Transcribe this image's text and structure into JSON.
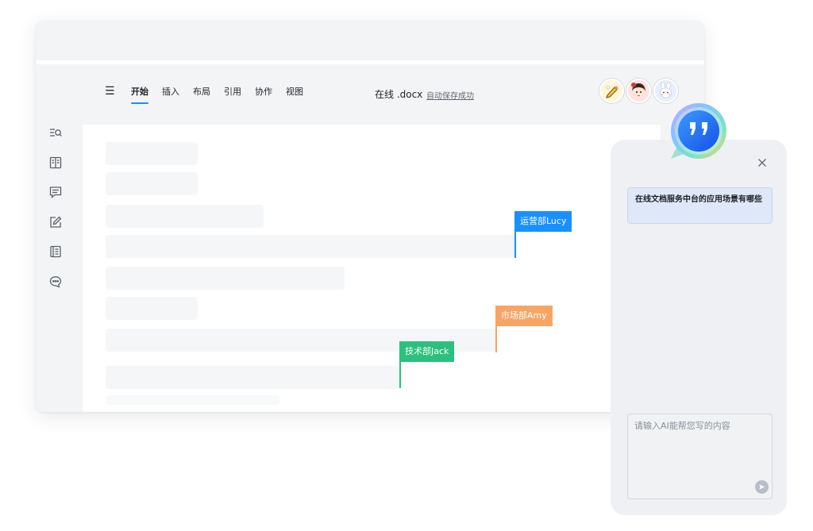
{
  "toolbar": {
    "menu_icon": "hamburger-menu-icon",
    "tabs": [
      {
        "label": "开始",
        "active": true
      },
      {
        "label": "插入",
        "active": false
      },
      {
        "label": "布局",
        "active": false
      },
      {
        "label": "引用",
        "active": false
      },
      {
        "label": "协作",
        "active": false
      },
      {
        "label": "视图",
        "active": false
      }
    ],
    "file_name": "在线 .docx",
    "save_status": "自动保存成功",
    "avatars": [
      "avatar-pencil",
      "avatar-girl",
      "avatar-bunny"
    ]
  },
  "sidebar": {
    "icons": [
      "list-search-icon",
      "book-icon",
      "comment-icon",
      "edit-icon",
      "document-icon",
      "chat-bubble-icon"
    ]
  },
  "collaborators": [
    {
      "name": "运营部Lucy",
      "color": "#1890ff"
    },
    {
      "name": "市场部Amy",
      "color": "#f7a565"
    },
    {
      "name": "技术部Jack",
      "color": "#2bc17c"
    }
  ],
  "ai_assistant": {
    "logo_icon": "ai-quote-logo-icon",
    "close_icon": "close-icon",
    "question": "在线文档服务中台的应用场景有哪些",
    "input_placeholder": "请输入AI能帮您写的内容",
    "send_icon": "send-icon"
  },
  "colors": {
    "accent": "#1890ff",
    "lucy": "#1890ff",
    "amy": "#f7a565",
    "jack": "#2bc17c"
  }
}
